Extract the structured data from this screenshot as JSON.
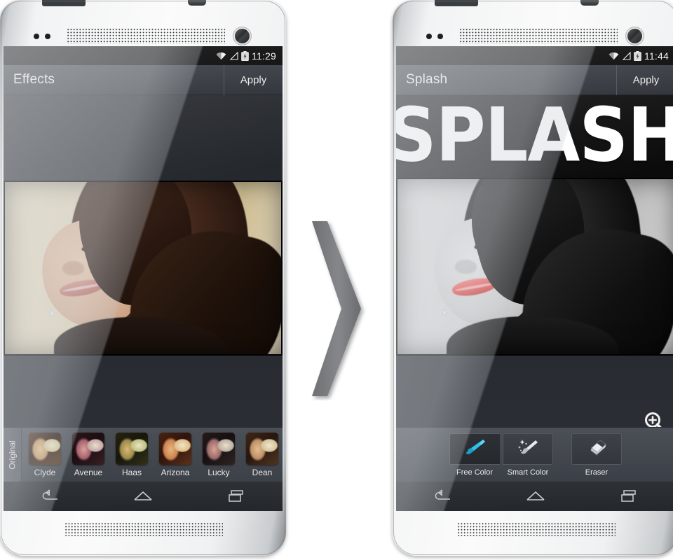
{
  "meta": {
    "title": "Splash photo editor — before and after comparison",
    "accent_cyan": "#30bde4",
    "splash_red": "#ef4a46",
    "bar_dark": "#2b2f35"
  },
  "arrow": {
    "name": "chevron-right",
    "color": "#7d7f82"
  },
  "left_phone": {
    "statusbar": {
      "time": "11:29",
      "icons": [
        "wifi-icon",
        "cell-signal-icon",
        "battery-charging-icon"
      ]
    },
    "actionbar": {
      "title": "Effects",
      "action_label": "Apply"
    },
    "photo": {
      "alt": "Portrait of woman with long dark hair, colour original"
    },
    "filter_strip": {
      "original_tab": "Original",
      "filters": [
        {
          "name": "Clyde",
          "tint": "rgba(196,170,120,0.45)"
        },
        {
          "name": "Avenue",
          "tint": "rgba(70,40,130,0.55)"
        },
        {
          "name": "Haas",
          "tint": "rgba(40,120,50,0.50)"
        },
        {
          "name": "Arizona",
          "tint": "rgba(200,110,60,0.45)"
        },
        {
          "name": "Lucky",
          "tint": "rgba(30,50,120,0.50)"
        },
        {
          "name": "Dean",
          "tint": "rgba(150,140,110,0.40)"
        }
      ]
    },
    "navbar": {
      "buttons": [
        "back-icon",
        "home-icon",
        "recents-icon"
      ]
    }
  },
  "right_phone": {
    "statusbar": {
      "time": "11:44",
      "icons": [
        "wifi-icon",
        "cell-signal-icon",
        "battery-charging-icon"
      ]
    },
    "actionbar": {
      "title": "Splash",
      "action_label": "Apply"
    },
    "wordmark": "SPLASH",
    "photo": {
      "alt": "Same portrait in black and white with red lips colour splash"
    },
    "zoom_icon": "zoom-in-icon",
    "tool_strip": {
      "tools": [
        {
          "name": "Free Color",
          "icon": "paintbrush-icon",
          "selected": true
        },
        {
          "name": "Smart Color",
          "icon": "magic-brush-icon",
          "selected": false
        },
        {
          "name": "Eraser",
          "icon": "eraser-icon",
          "selected": false
        }
      ]
    },
    "navbar": {
      "buttons": [
        "back-icon",
        "home-icon",
        "recents-icon"
      ]
    }
  }
}
